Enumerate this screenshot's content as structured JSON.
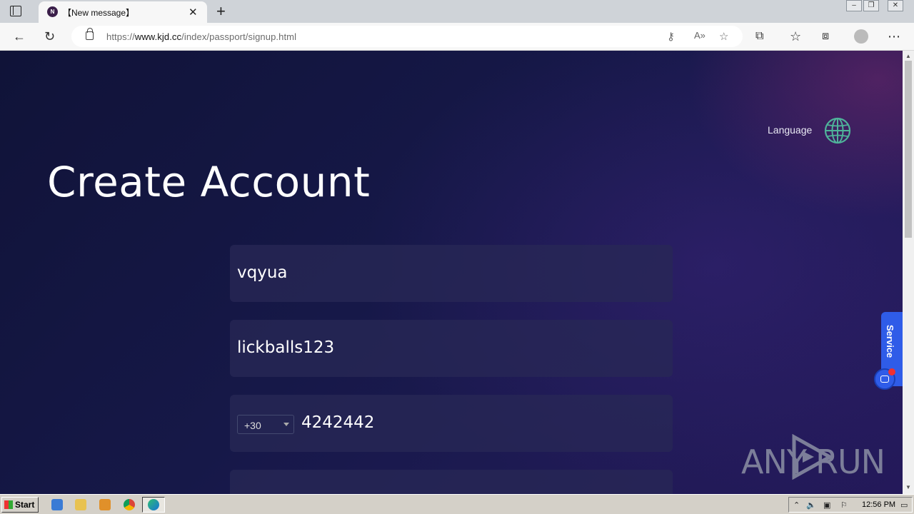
{
  "browser": {
    "tab_title": "【New message】",
    "tab_favicon_letter": "N",
    "url_prefix": "https://",
    "url_host": "www.kjd.cc",
    "url_path": "/index/passport/signup.html"
  },
  "page": {
    "language_label": "Language",
    "title": "Create Account",
    "fields": {
      "username_value": "vqyua",
      "password_value": "lickballs123",
      "country_code": "+30",
      "phone_value": "4242442"
    },
    "service_label": "Service"
  },
  "watermark": {
    "left_text": "ANY",
    "right_text": "RUN"
  },
  "taskbar": {
    "start_label": "Start",
    "clock": "12:56 PM"
  },
  "colors": {
    "accent_globe": "#4fb39a",
    "service_blue": "#2f5ce8",
    "page_bg": "#151746"
  }
}
